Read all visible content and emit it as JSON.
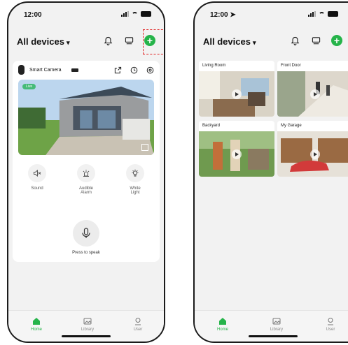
{
  "colors": {
    "accent": "#26b44a",
    "highlight": "#e02020"
  },
  "left": {
    "status": {
      "time": "12:00"
    },
    "header": {
      "title": "All devices"
    },
    "camera": {
      "name": "Smart Camera",
      "live": "Live"
    },
    "controls": [
      {
        "label": "Sound",
        "icon": "mute-icon"
      },
      {
        "label": "Audible\nAlarm",
        "icon": "alarm-icon"
      },
      {
        "label": "White\nLight",
        "icon": "light-icon"
      }
    ],
    "speak": "Press to speak"
  },
  "right": {
    "status": {
      "time": "12:00"
    },
    "header": {
      "title": "All devices"
    },
    "tiles": [
      "Living Room",
      "Front Door",
      "Backyard",
      "My Garage"
    ]
  },
  "tabs": [
    "Home",
    "Library",
    "User"
  ]
}
